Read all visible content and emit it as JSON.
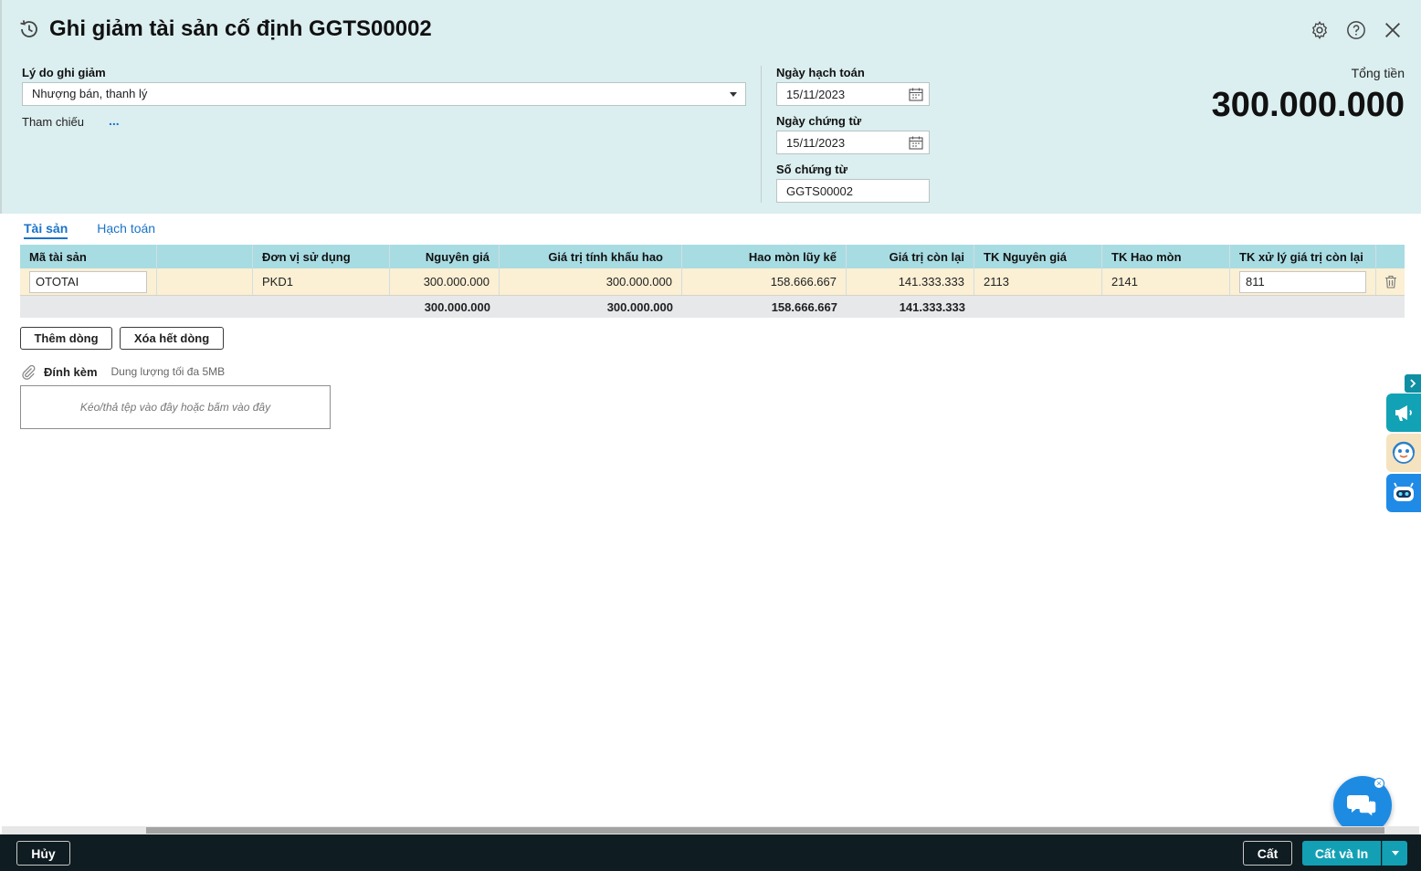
{
  "header": {
    "title": "Ghi giảm tài sản cố định GGTS00002",
    "icons": [
      "history-icon",
      "gear-icon",
      "help-icon",
      "close-icon"
    ]
  },
  "form": {
    "reason_label": "Lý do ghi giảm",
    "reason_value": "Nhượng bán, thanh lý",
    "reference_label": "Tham chiếu",
    "reference_more": "...",
    "posting_date_label": "Ngày hạch toán",
    "posting_date_value": "15/11/2023",
    "voucher_date_label": "Ngày chứng từ",
    "voucher_date_value": "15/11/2023",
    "voucher_no_label": "Số chứng từ",
    "voucher_no_value": "GGTS00002",
    "total_label": "Tổng tiền",
    "total_value": "300.000.000"
  },
  "tabs": [
    {
      "label": "Tài sản",
      "active": true
    },
    {
      "label": "Hạch toán",
      "active": false
    }
  ],
  "grid": {
    "columns": [
      "Mã tài sản",
      "",
      "Đơn vị sử dụng",
      "Nguyên giá",
      "Giá trị tính khấu hao",
      "Hao mòn lũy kế",
      "Giá trị còn lại",
      "TK Nguyên giá",
      "TK Hao mòn",
      "TK xử lý giá trị còn lại"
    ],
    "rows": [
      {
        "asset_code": "OTOTAI",
        "name": "",
        "department": "PKD1",
        "original_cost": "300.000.000",
        "depreciable_value": "300.000.000",
        "accumulated_depreciation": "158.666.667",
        "remaining_value": "141.333.333",
        "cost_account": "2113",
        "depreciation_account": "2141",
        "remaining_account": "811"
      }
    ],
    "totals": {
      "original_cost": "300.000.000",
      "depreciable_value": "300.000.000",
      "accumulated_depreciation": "158.666.667",
      "remaining_value": "141.333.333"
    }
  },
  "buttons": {
    "add_row": "Thêm dòng",
    "clear_rows": "Xóa hết dòng"
  },
  "attachment": {
    "label": "Đính kèm",
    "hint": "Dung lượng tối đa 5MB",
    "dropzone": "Kéo/thả tệp vào đây hoặc bấm vào đây"
  },
  "footer": {
    "cancel": "Hủy",
    "save": "Cất",
    "save_print": "Cất và In"
  },
  "colors": {
    "header_bg": "#dbeef0",
    "grid_head": "#a8dce3",
    "row_bg": "#fbefd4",
    "link": "#1a73c7",
    "footer_bg": "#0f1c21",
    "primary": "#14a0b4"
  }
}
